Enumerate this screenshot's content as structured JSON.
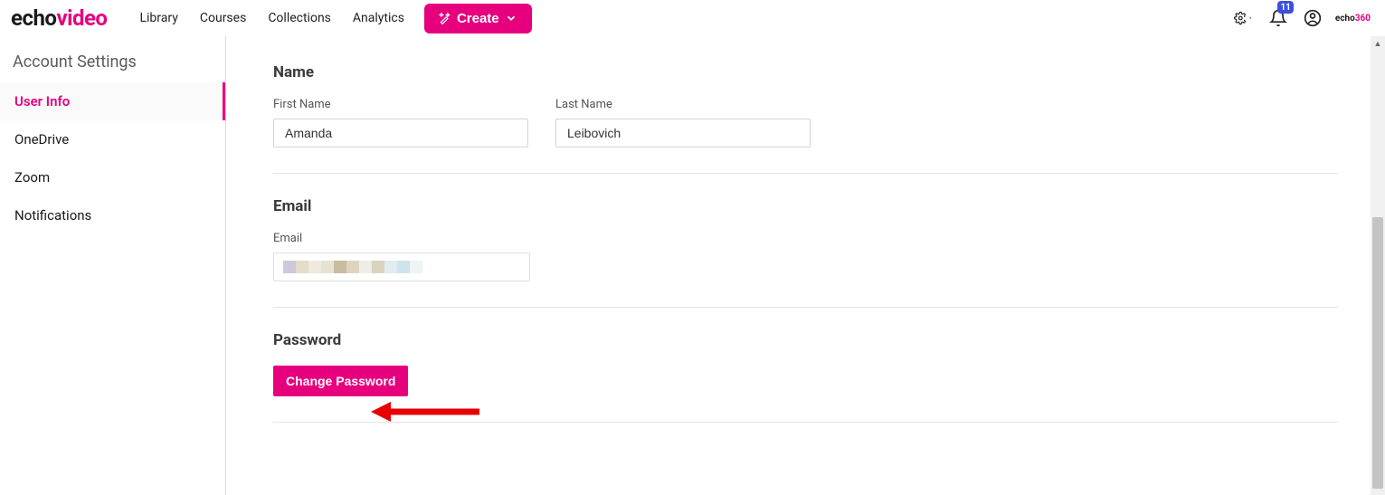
{
  "brand": {
    "part1": "echo",
    "part2": "video"
  },
  "nav": {
    "library": "Library",
    "courses": "Courses",
    "collections": "Collections",
    "analytics": "Analytics",
    "create": "Create"
  },
  "header": {
    "notif_count": "11",
    "mini_brand1": "echo",
    "mini_brand2": "360"
  },
  "sidebar": {
    "title": "Account Settings",
    "items": {
      "user_info": "User Info",
      "onedrive": "OneDrive",
      "zoom": "Zoom",
      "notifications": "Notifications"
    }
  },
  "sections": {
    "name": {
      "heading": "Name",
      "first_label": "First Name",
      "first_value": "Amanda",
      "last_label": "Last Name",
      "last_value": "Leibovich"
    },
    "email": {
      "heading": "Email",
      "label": "Email"
    },
    "password": {
      "heading": "Password",
      "button": "Change Password"
    }
  }
}
